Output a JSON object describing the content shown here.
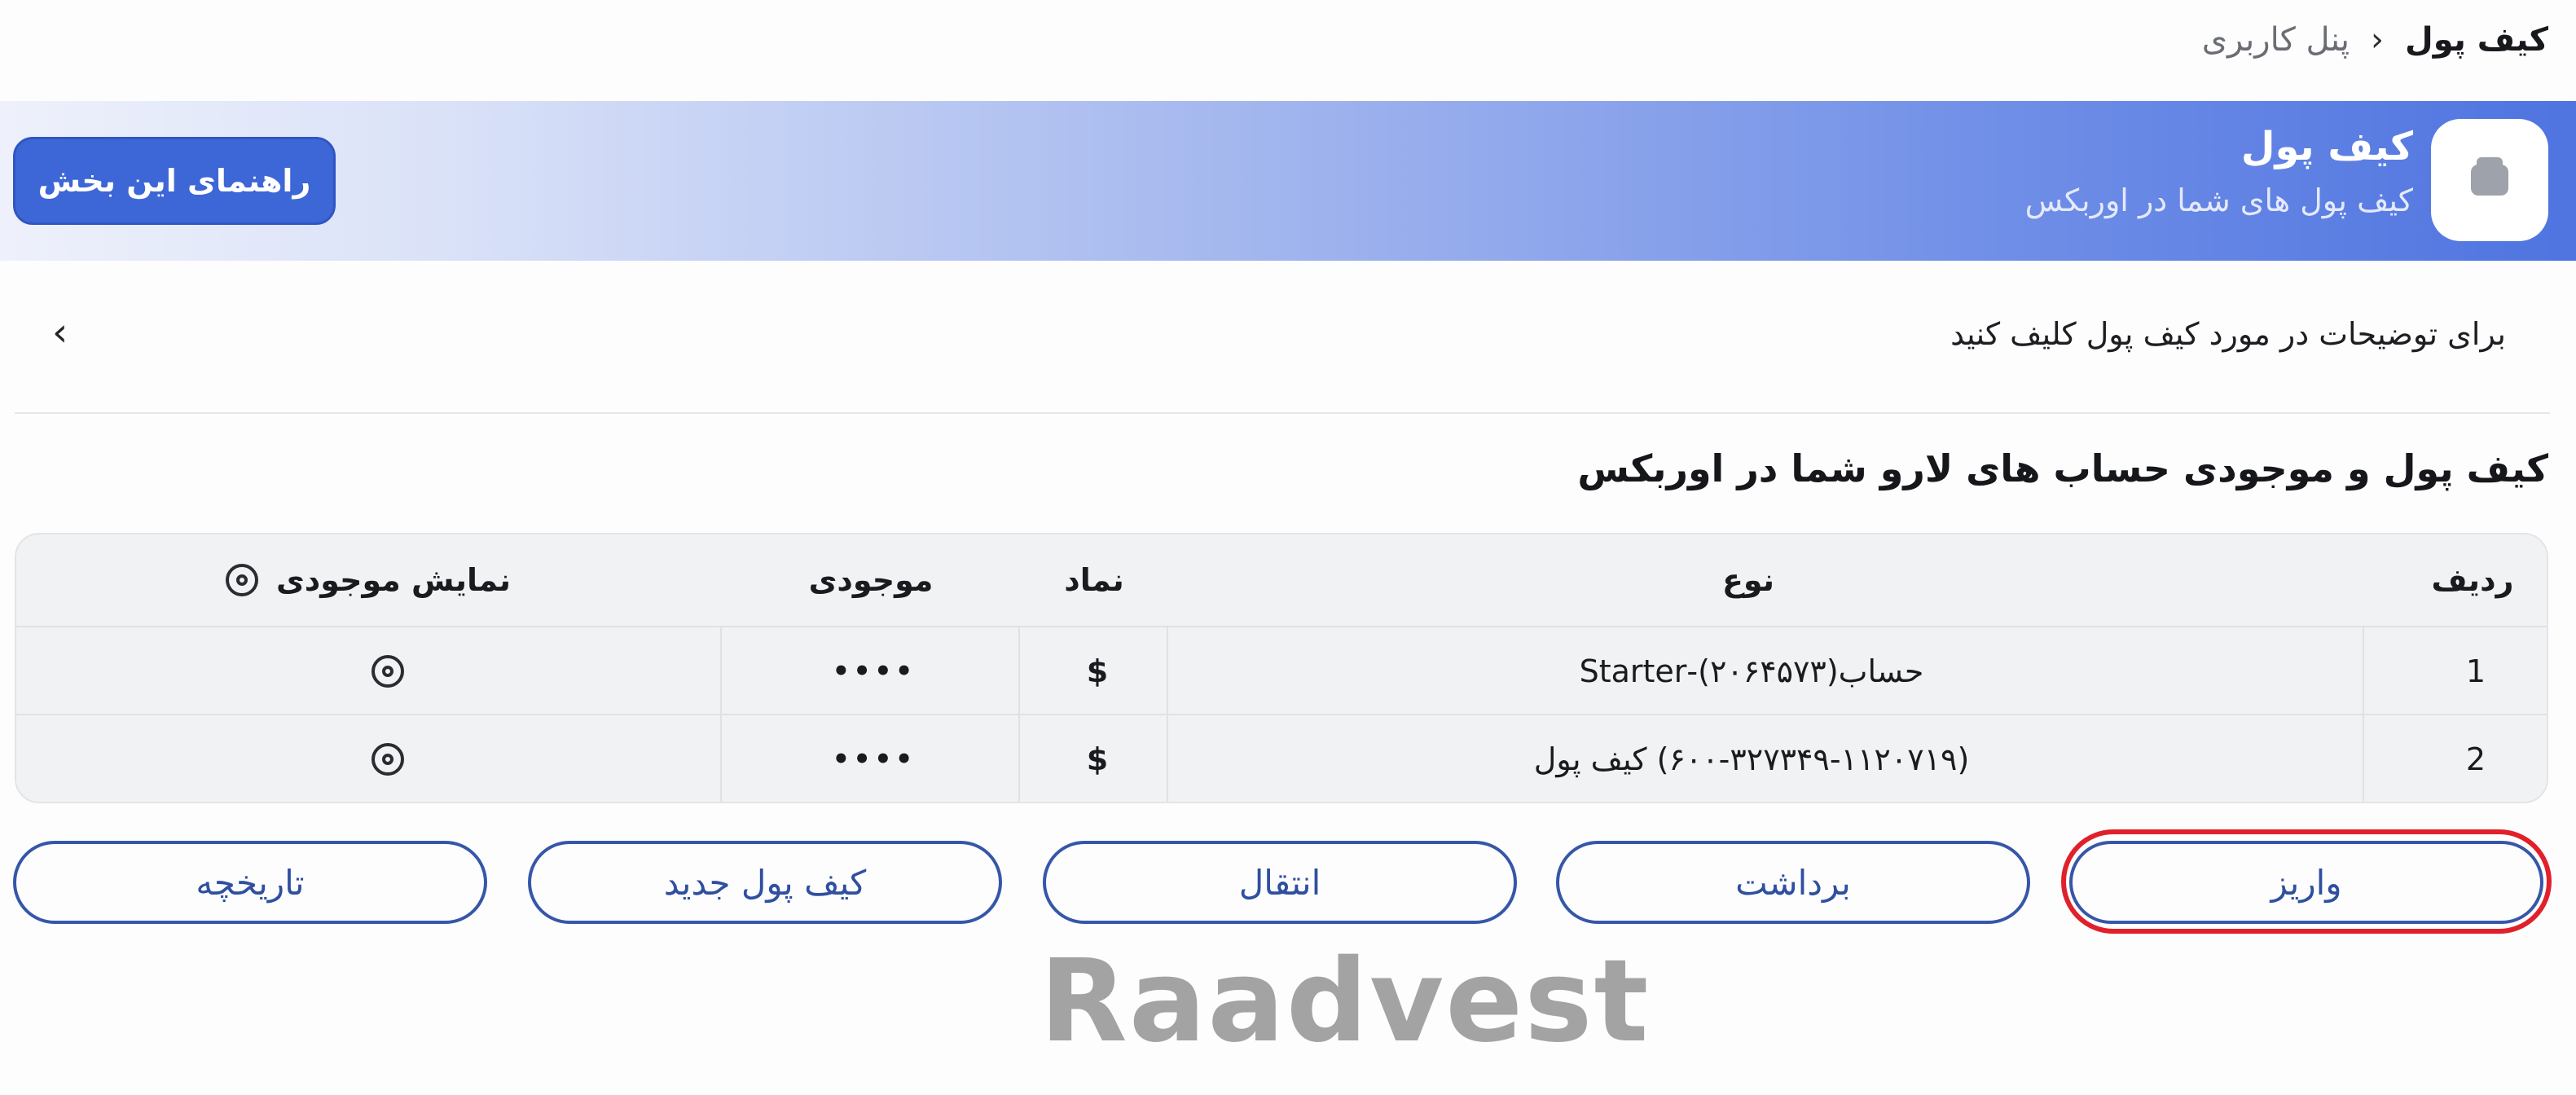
{
  "breadcrumb": {
    "root": "پنل کاربری",
    "current": "کیف پول"
  },
  "banner": {
    "title": "کیف پول",
    "subtitle": "کیف پول های شما در اوربکس",
    "guide_button": "راهنمای این بخش",
    "icon": "wallet-icon"
  },
  "info": {
    "text": "برای توضیحات در مورد کیف پول کلیف کنید"
  },
  "section_title": "کیف پول و موجودی حساب های لارو شما در اوربکس",
  "table": {
    "headers": {
      "row": "ردیف",
      "type": "نوع",
      "symbol": "نماد",
      "balance": "موجودی",
      "show_balance": "نمایش موجودی"
    },
    "rows": [
      {
        "index": "1",
        "type": "حساب(۲۰۶۴۵۷۳)-Starter",
        "symbol": "$",
        "balance": "••••"
      },
      {
        "index": "2",
        "type": "(۶۰۰-۳۲۷۳۴۹-۱۱۲۰۷۱۹) کیف پول",
        "symbol": "$",
        "balance": "••••"
      }
    ]
  },
  "actions": {
    "deposit": "واریز",
    "withdraw": "برداشت",
    "transfer": "انتقال",
    "new_wallet": "کیف پول جدید",
    "history": "تاریخچه"
  },
  "watermark": "Raadvest",
  "colors": {
    "accent": "#3d66d6",
    "button_border": "#3656a8",
    "highlight": "#e0202a"
  }
}
